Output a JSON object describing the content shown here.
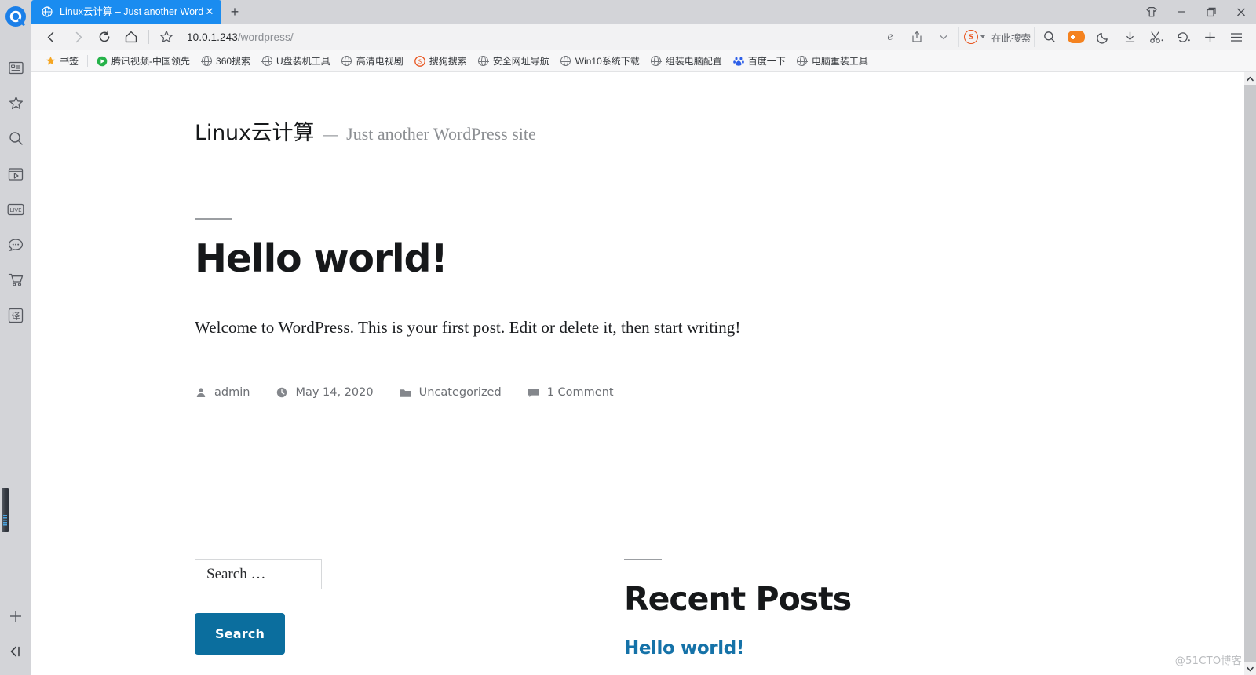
{
  "browser": {
    "name": "QQ Browser",
    "tab": {
      "title": "Linux云计算 – Just another WordP",
      "favicon": "globe-icon",
      "close_label": "✕"
    },
    "new_tab_label": "+",
    "window_controls": [
      {
        "name": "skin-button",
        "label": "♕"
      },
      {
        "name": "minimize-button",
        "label": "—"
      },
      {
        "name": "maximize-button",
        "label": "❐"
      },
      {
        "name": "close-button",
        "label": "✕"
      }
    ],
    "nav": {
      "back": "‹",
      "forward": "›",
      "reload": "⟳",
      "home": "⌂",
      "bookmark_star": "☆",
      "url_host": "10.0.1.243",
      "url_path": "/wordpress/",
      "ie_mode": "e",
      "share": "⇪",
      "chevron": "⌄"
    },
    "search_box": {
      "engine_badge": "S",
      "placeholder": "在此搜索"
    },
    "toolbar_right": [
      {
        "name": "search-icon",
        "label": "⌕"
      },
      {
        "name": "game-center-icon",
        "label": ""
      },
      {
        "name": "night-mode-icon",
        "label": "☾"
      },
      {
        "name": "downloads-icon",
        "label": "↓"
      },
      {
        "name": "screenshot-icon",
        "label": "✂"
      },
      {
        "name": "history-icon",
        "label": "↺"
      },
      {
        "name": "add-icon",
        "label": "+"
      },
      {
        "name": "menu-icon",
        "label": "☰"
      }
    ],
    "bookmarks": [
      {
        "label": "书签",
        "icon": "star-icon"
      },
      {
        "label": "腾讯视频-中国领先",
        "icon": "play-icon"
      },
      {
        "label": "360搜索",
        "icon": "globe-icon"
      },
      {
        "label": "U盘装机工具",
        "icon": "globe-icon"
      },
      {
        "label": "高清电视剧",
        "icon": "globe-icon"
      },
      {
        "label": "搜狗搜索",
        "icon": "sogou-icon"
      },
      {
        "label": "安全网址导航",
        "icon": "globe-icon"
      },
      {
        "label": "Win10系统下载",
        "icon": "globe-icon"
      },
      {
        "label": "组装电脑配置",
        "icon": "globe-icon"
      },
      {
        "label": "百度一下",
        "icon": "baidu-icon"
      },
      {
        "label": "电脑重装工具",
        "icon": "globe-icon"
      }
    ],
    "sidebar_icons": [
      {
        "name": "reading-list-icon",
        "label": "▤"
      },
      {
        "name": "favorites-icon",
        "label": "☆"
      },
      {
        "name": "search-icon",
        "label": "⌕"
      },
      {
        "name": "video-icon",
        "label": "▷"
      },
      {
        "name": "live-icon",
        "label": "LIVE"
      },
      {
        "name": "chat-icon",
        "label": "💬"
      },
      {
        "name": "cart-icon",
        "label": "🛒"
      },
      {
        "name": "translate-icon",
        "label": "译"
      }
    ],
    "sidebar_bottom": [
      {
        "name": "add-panel-icon",
        "label": "+"
      },
      {
        "name": "collapse-sidebar-icon",
        "label": "❮|"
      }
    ],
    "scrollbar": {
      "up": "⌃",
      "down": "⌄"
    }
  },
  "site": {
    "title": "Linux云计算",
    "separator": "—",
    "tagline": "Just another WordPress site"
  },
  "post": {
    "title": "Hello world!",
    "body": "Welcome to WordPress. This is your first post. Edit or delete it, then start writing!",
    "meta": {
      "author": "admin",
      "date": "May 14, 2020",
      "category": "Uncategorized",
      "comments": "1 Comment"
    }
  },
  "search_widget": {
    "placeholder": "Search …",
    "button_label": "Search",
    "button_color": "#0b6e9e"
  },
  "recent_posts": {
    "heading": "Recent Posts",
    "items": [
      {
        "label": "Hello world!"
      }
    ],
    "link_color": "#1572a8"
  },
  "watermark": "@51CTO博客"
}
